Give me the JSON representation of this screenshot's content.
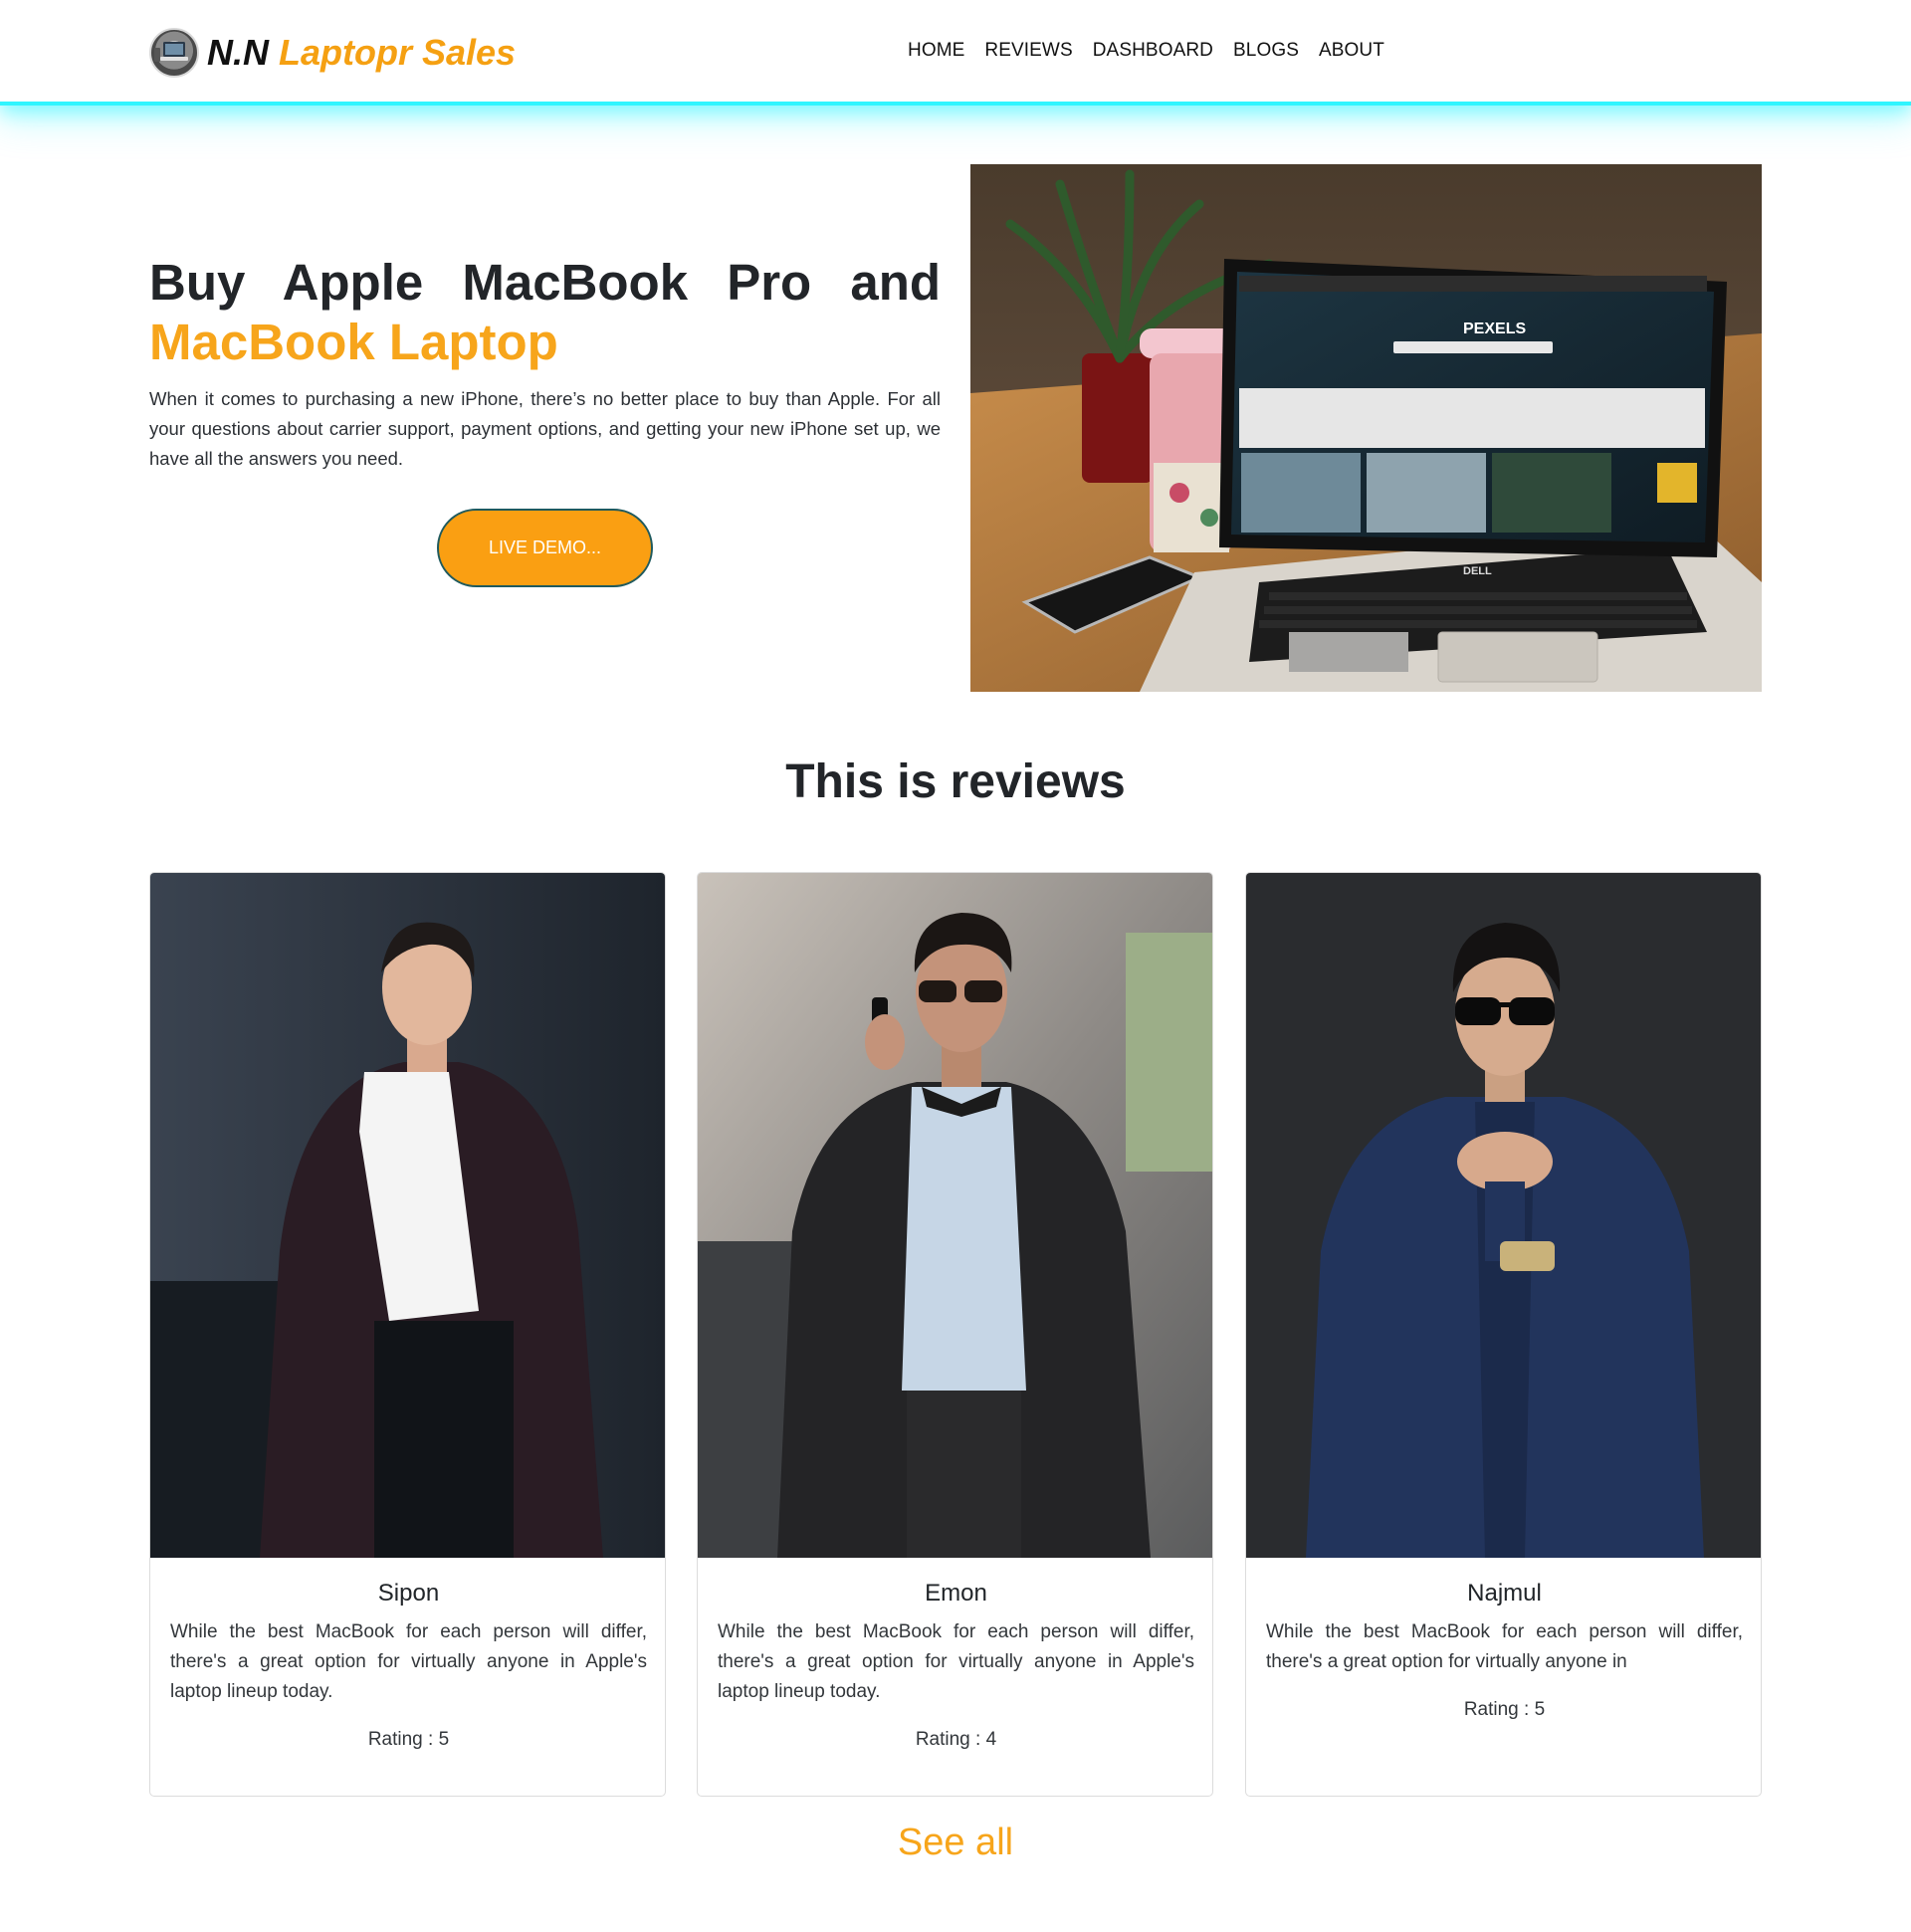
{
  "brand": {
    "name_part1": "N.N",
    "name_part2": "Laptopr Sales",
    "logo_icon": "laptop-logo-icon"
  },
  "nav": {
    "items": [
      {
        "label": "HOME"
      },
      {
        "label": "REVIEWS"
      },
      {
        "label": "DASHBOARD"
      },
      {
        "label": "BLOGS"
      },
      {
        "label": "ABOUT"
      }
    ]
  },
  "hero": {
    "title": "Buy Apple MacBook Pro and",
    "title_accent": "MacBook Laptop",
    "description": "When it comes to purchasing a new iPhone, there’s no better place to buy than Apple. For all your questions about carrier support, payment options, and getting your new iPhone set up, we have all the answers you need.",
    "button_label": "LIVE DEMO...",
    "image_screen_text": "PEXELS",
    "image_brand_text": "DELL"
  },
  "reviews": {
    "title": "This is reviews",
    "cards": [
      {
        "name": "Sipon",
        "text": "While the best MacBook for each person will differ, there's a great option for virtually anyone in Apple's laptop lineup today.",
        "rating": "Rating : 5"
      },
      {
        "name": "Emon",
        "text": "While the best MacBook for each person will differ, there's a great option for virtually anyone in Apple's laptop lineup today.",
        "rating": "Rating : 4"
      },
      {
        "name": "Najmul",
        "text": "While the best MacBook for each person will differ, there's a great option for virtually anyone in",
        "rating": "Rating : 5"
      }
    ],
    "see_all_label": "See all"
  },
  "colors": {
    "accent": "#f7a51b",
    "button": "#fa9f12",
    "nav_glow": "#2ff5ff",
    "text_dark": "#212529"
  }
}
